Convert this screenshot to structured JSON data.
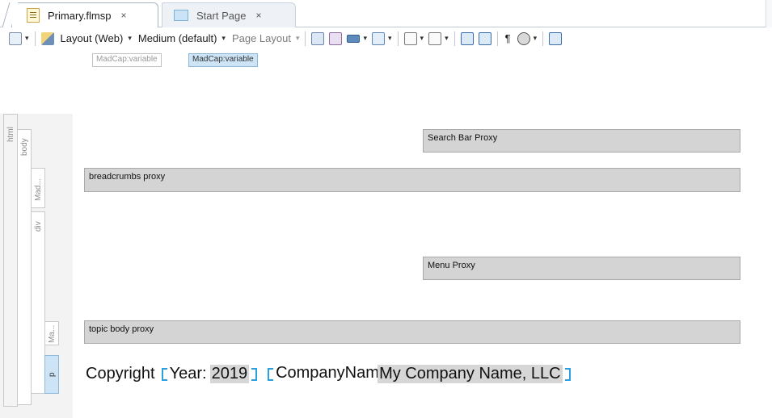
{
  "tabs": [
    {
      "label": "Primary.flmsp",
      "close": "×",
      "active": true,
      "icon": "document-icon"
    },
    {
      "label": "Start Page",
      "close": "×",
      "active": false,
      "icon": "start-page-icon"
    }
  ],
  "toolbar": {
    "layout_label": "Layout (Web)",
    "medium_label": "Medium (default)",
    "page_layout_label": "Page Layout",
    "caret": "▾",
    "pilcrow": "¶"
  },
  "chips": [
    "MadCap:variable",
    "MadCap:variable"
  ],
  "structure": {
    "html": "html",
    "body": "body",
    "mad": "Mad...",
    "div": "div",
    "ma": "Ma...",
    "p": "p"
  },
  "proxies": {
    "search": "Search Bar Proxy",
    "breadcrumbs": "breadcrumbs proxy",
    "menu": "Menu Proxy",
    "topic_body": "topic body proxy"
  },
  "footer": {
    "copyright": "Copyright",
    "year_label": "Year:",
    "year_value": "2019",
    "company_label": "CompanyName:",
    "company_value": "My Company Name, LLC"
  },
  "colors": {
    "accent": "#2aa0e0",
    "proxy_fill": "#d4d4d4",
    "selected_chip": "#cde4f6"
  }
}
